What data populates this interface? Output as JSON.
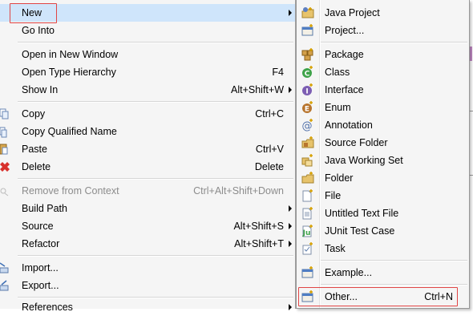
{
  "main_menu": {
    "items": [
      {
        "label": "New",
        "shortcut": "",
        "submenu": true
      },
      {
        "label": "Go Into",
        "shortcut": ""
      },
      {
        "label": "Open in New Window",
        "shortcut": ""
      },
      {
        "label": "Open Type Hierarchy",
        "shortcut": "F4"
      },
      {
        "label": "Show In",
        "shortcut": "Alt+Shift+W",
        "submenu": true
      },
      {
        "label": "Copy",
        "shortcut": "Ctrl+C"
      },
      {
        "label": "Copy Qualified Name",
        "shortcut": ""
      },
      {
        "label": "Paste",
        "shortcut": "Ctrl+V"
      },
      {
        "label": "Delete",
        "shortcut": "Delete"
      },
      {
        "label": "Remove from Context",
        "shortcut": "Ctrl+Alt+Shift+Down",
        "disabled": true
      },
      {
        "label": "Build Path",
        "shortcut": "",
        "submenu": true
      },
      {
        "label": "Source",
        "shortcut": "Alt+Shift+S",
        "submenu": true
      },
      {
        "label": "Refactor",
        "shortcut": "Alt+Shift+T",
        "submenu": true
      },
      {
        "label": "Import...",
        "shortcut": ""
      },
      {
        "label": "Export...",
        "shortcut": ""
      },
      {
        "label": "References",
        "shortcut": "",
        "submenu": true
      }
    ]
  },
  "sub_menu": {
    "items": [
      {
        "label": "Java Project",
        "shortcut": "",
        "icon": "java-project-icon"
      },
      {
        "label": "Project...",
        "shortcut": "",
        "icon": "project-icon"
      },
      {
        "label": "Package",
        "shortcut": "",
        "icon": "package-icon"
      },
      {
        "label": "Class",
        "shortcut": "",
        "icon": "class-icon"
      },
      {
        "label": "Interface",
        "shortcut": "",
        "icon": "interface-icon"
      },
      {
        "label": "Enum",
        "shortcut": "",
        "icon": "enum-icon"
      },
      {
        "label": "Annotation",
        "shortcut": "",
        "icon": "annotation-icon"
      },
      {
        "label": "Source Folder",
        "shortcut": "",
        "icon": "source-folder-icon"
      },
      {
        "label": "Java Working Set",
        "shortcut": "",
        "icon": "working-set-icon"
      },
      {
        "label": "Folder",
        "shortcut": "",
        "icon": "folder-icon"
      },
      {
        "label": "File",
        "shortcut": "",
        "icon": "file-icon"
      },
      {
        "label": "Untitled Text File",
        "shortcut": "",
        "icon": "text-file-icon"
      },
      {
        "label": "JUnit Test Case",
        "shortcut": "",
        "icon": "junit-icon"
      },
      {
        "label": "Task",
        "shortcut": "",
        "icon": "task-icon"
      },
      {
        "label": "Example...",
        "shortcut": "",
        "icon": "example-icon"
      },
      {
        "label": "Other...",
        "shortcut": "Ctrl+N",
        "icon": "other-wizard-icon"
      }
    ]
  },
  "colors": {
    "menu_bg": "#f5f5f5",
    "highlight": "#cfe5fb",
    "outline": "#e04545",
    "disabled_text": "#8c8c8c"
  }
}
